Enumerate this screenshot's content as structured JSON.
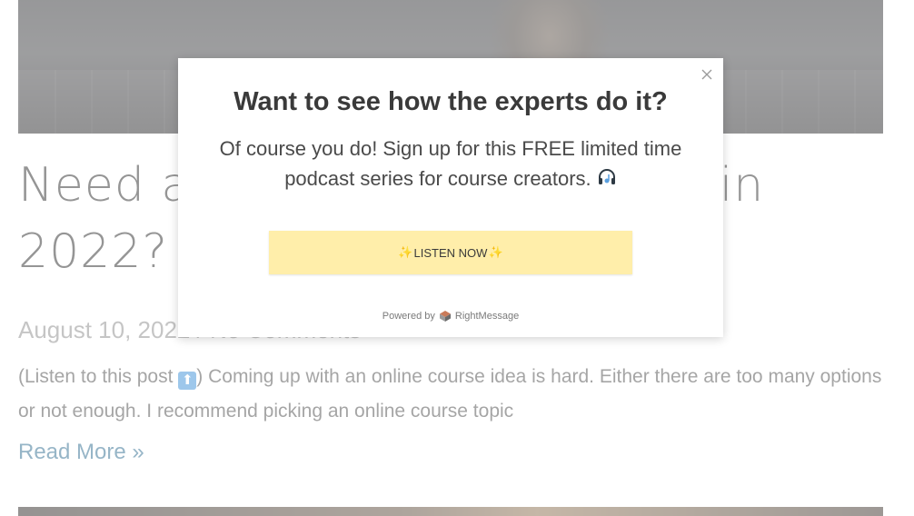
{
  "post": {
    "title": "Need an Online Course Idea in 2022? Ask These Questions",
    "date": "August 10, 2022",
    "separator": "/",
    "comments": "No Comments",
    "excerpt_before": "(Listen to this post ",
    "excerpt_after": ") Coming up with an online course idea is hard. Either there are too many options or not enough.  I recommend picking an online course topic",
    "up_arrow_icon": "up-arrow-emoji",
    "read_more": "Read More »"
  },
  "modal": {
    "heading": "Want to see how the experts do it?",
    "body": "Of course you do! Sign up for this FREE limited time podcast series for course creators.",
    "body_icon": "headphones-icon",
    "cta_label": "LISTEN NOW",
    "cta_sparkle": "✨",
    "powered_by": "Powered by",
    "brand": "RightMessage",
    "close_icon": "close-icon"
  },
  "colors": {
    "cta_background": "#ffeeaa",
    "link": "#2d6a8e",
    "heading": "#3a3a3a"
  }
}
